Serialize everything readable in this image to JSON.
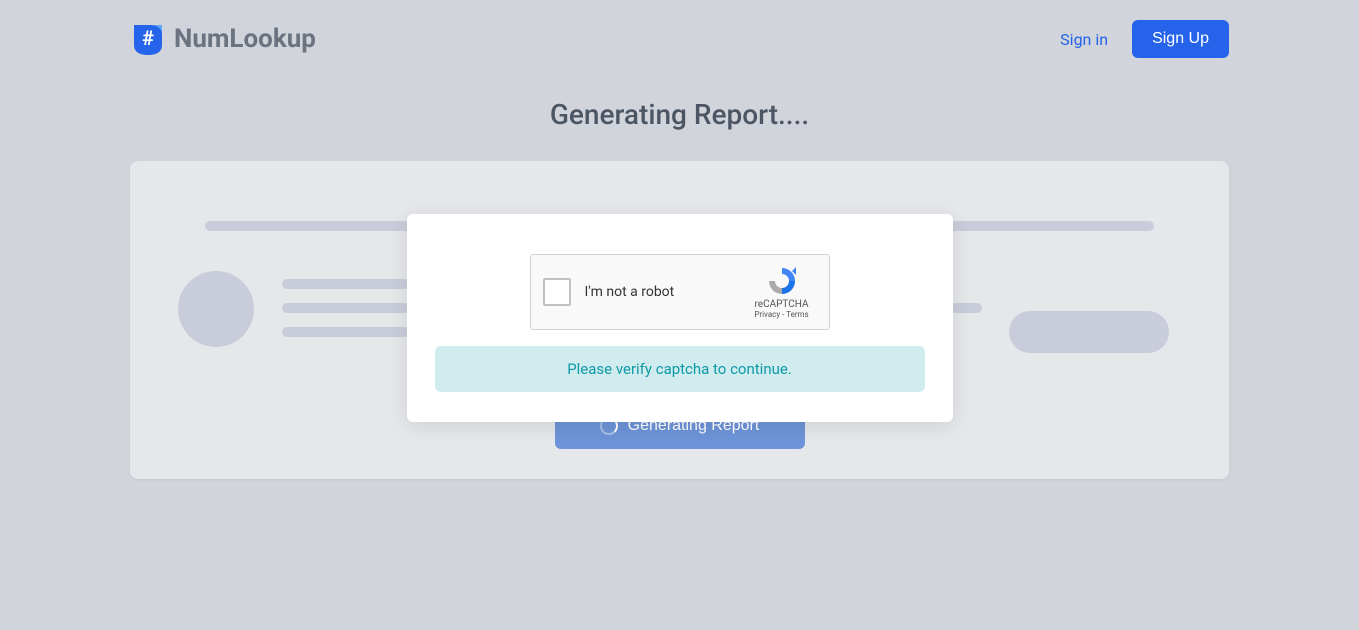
{
  "header": {
    "brand_name": "NumLookup",
    "sign_in": "Sign in",
    "sign_up": "Sign Up"
  },
  "page": {
    "title": "Generating Report....",
    "button_label": "Generating Report"
  },
  "modal": {
    "recaptcha_label": "I'm not a robot",
    "recaptcha_brand": "reCAPTCHA",
    "recaptcha_privacy": "Privacy",
    "recaptcha_terms": "Terms",
    "alert_text": "Please verify captcha to continue."
  }
}
